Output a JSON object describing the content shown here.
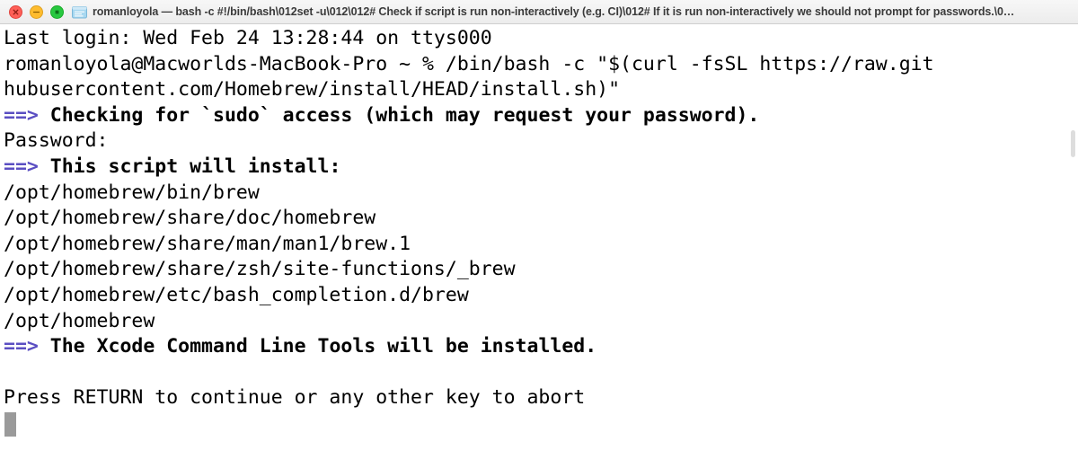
{
  "window": {
    "title": "romanloyola — bash -c #!/bin/bash\\012set -u\\012\\012# Check if script is run non-interactively (e.g. CI)\\012# If it is run non-interactively we should not prompt for passwords.\\0…",
    "traffic_lights": {
      "close_label": "close",
      "minimize_label": "minimize",
      "maximize_label": "maximize"
    },
    "doc_icon_name": "terminal-document-icon"
  },
  "colors": {
    "accent_purple": "#5a4ec2",
    "text": "#000000",
    "background": "#ffffff",
    "titlebar_bg": "#f1f1f1",
    "cursor": "#9a9a9a"
  },
  "terminal": {
    "lines": [
      {
        "id": "line-last-login",
        "text": "Last login: Wed Feb 24 13:28:44 on ttys000"
      },
      {
        "id": "line-prompt-command",
        "text": "romanloyola@Macworlds-MacBook-Pro ~ % /bin/bash -c \"$(curl -fsSL https://raw.git"
      },
      {
        "id": "line-command-wrap",
        "text": "hubusercontent.com/Homebrew/install/HEAD/install.sh)\""
      },
      {
        "id": "line-checking-sudo",
        "arrow": "==>",
        "bold": " Checking for `sudo` access (which may request your password)."
      },
      {
        "id": "line-password-prompt",
        "text": "Password:"
      },
      {
        "id": "line-script-will-install",
        "arrow": "==>",
        "bold": " This script will install:"
      },
      {
        "id": "line-path-brew-bin",
        "text": "/opt/homebrew/bin/brew"
      },
      {
        "id": "line-path-share-doc",
        "text": "/opt/homebrew/share/doc/homebrew"
      },
      {
        "id": "line-path-man",
        "text": "/opt/homebrew/share/man/man1/brew.1"
      },
      {
        "id": "line-path-zsh",
        "text": "/opt/homebrew/share/zsh/site-functions/_brew"
      },
      {
        "id": "line-path-bash-comp",
        "text": "/opt/homebrew/etc/bash_completion.d/brew"
      },
      {
        "id": "line-path-root",
        "text": "/opt/homebrew"
      },
      {
        "id": "line-xcode-tools",
        "arrow": "==>",
        "bold": " The Xcode Command Line Tools will be installed."
      },
      {
        "id": "line-blank",
        "text": " "
      },
      {
        "id": "line-press-return",
        "text": "Press RETURN to continue or any other key to abort"
      }
    ]
  }
}
